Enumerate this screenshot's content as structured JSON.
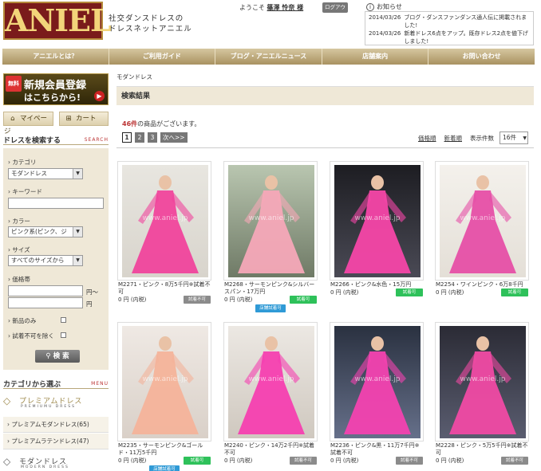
{
  "header": {
    "logo_text": "ANIEL",
    "tagline_line1": "社交ダンスドレスの",
    "tagline_line2": "ドレスネットアニエル",
    "welcome_prefix": "ようこそ",
    "user_name": "篠澤 怜奈 様",
    "logout_label": "ログアウト",
    "news_title": "お知らせ",
    "news": [
      {
        "date": "2014/03/26",
        "text": "ブログ・ダンスファンダンス通人伝に掲載されました!"
      },
      {
        "date": "2014/03/26",
        "text": "新着ドレス6点をアップ。既存ドレス2点を値下げしました!"
      }
    ]
  },
  "nav": [
    "アニエルとは？",
    "ご利用ガイド",
    "ブログ・アニエルニュース",
    "店舗案内",
    "お問い合わせ"
  ],
  "sidebar": {
    "signup_badge": "無料",
    "signup_line1": "新規会員登録",
    "signup_line2": "はこちらから!",
    "mypage_label": "マイページ",
    "cart_label": "カート",
    "search_title": "ドレスを検索する",
    "search_title_en": "SEARCH",
    "category_label": "カテゴリ",
    "category_value": "モダンドレス",
    "keyword_label": "キーワード",
    "keyword_value": "",
    "color_label": "カラー",
    "color_value": "ピンク系(ピンク、ジ",
    "size_label": "サイズ",
    "size_value": "すべてのサイズから",
    "price_label": "価格帯",
    "price_from_suffix": "円～",
    "price_to_suffix": "円",
    "new_only_label": "新品のみ",
    "exclude_label": "試着不可を除く",
    "search_button": "検 索",
    "category_title": "カテゴリから選ぶ",
    "category_title_en": "MENU",
    "premium_title": "プレミアムドレス",
    "premium_sub": "PREMIUMU DRESS",
    "premium_links": [
      "プレミアムモダンドレス(65)",
      "プレミアムラテンドレス(47)"
    ],
    "modern_title": "モダンドレス",
    "modern_sub": "MODERN DRESS"
  },
  "main": {
    "breadcrumb": "モダンドレス",
    "result_title": "検索結果",
    "count_number": "46件",
    "count_suffix": "の商品がございます。",
    "pages": [
      "1",
      "2",
      "3",
      "次へ>>"
    ],
    "sort_price": "価格順",
    "sort_new": "新着順",
    "per_page_label": "表示件数",
    "per_page_value": "16件",
    "products": [
      {
        "name": "M2271・ピンク・8万5千円※試着不可",
        "price": "0 円 (内税)",
        "tags": [
          "試着不可"
        ],
        "tag_kinds": [
          "ng"
        ]
      },
      {
        "name": "M2268・サーモンピンク&シルバースパン・17万円",
        "price": "0 円 (内税)",
        "tags": [
          "試着可",
          "店舗試着可"
        ],
        "tag_kinds": [
          "ok",
          "store"
        ]
      },
      {
        "name": "M2266・ピンク&水色・15万円",
        "price": "0 円 (内税)",
        "tags": [
          "試着可"
        ],
        "tag_kinds": [
          "ok"
        ]
      },
      {
        "name": "M2254・ワインピンク・6万8千円",
        "price": "0 円 (内税)",
        "tags": [
          "試着可"
        ],
        "tag_kinds": [
          "ok"
        ]
      },
      {
        "name": "M2235・サーモンピンク&ゴールド・11万5千円",
        "price": "0 円 (内税)",
        "tags": [
          "試着可",
          "店舗試着可"
        ],
        "tag_kinds": [
          "ok",
          "store"
        ]
      },
      {
        "name": "M2240・ピンク・14万2千円※試着不可",
        "price": "0 円 (内税)",
        "tags": [
          "試着不可"
        ],
        "tag_kinds": [
          "ng"
        ]
      },
      {
        "name": "M2236・ピンク&黒・11万7千円※試着不可",
        "price": "0 円 (内税)",
        "tags": [
          "試着不可"
        ],
        "tag_kinds": [
          "ng"
        ]
      },
      {
        "name": "M2228・ピンク・5万5千円※試着不可",
        "price": "0 円 (内税)",
        "tags": [
          "試着不可"
        ],
        "tag_kinds": [
          "ng"
        ]
      }
    ]
  },
  "watermark": "www.aniel.jp",
  "colors": {
    "accent": "#b8a06a",
    "ok": "#2ec15a",
    "ng": "#8b8b8b",
    "store": "#2f9ad6",
    "pink": "#f03fa0"
  }
}
